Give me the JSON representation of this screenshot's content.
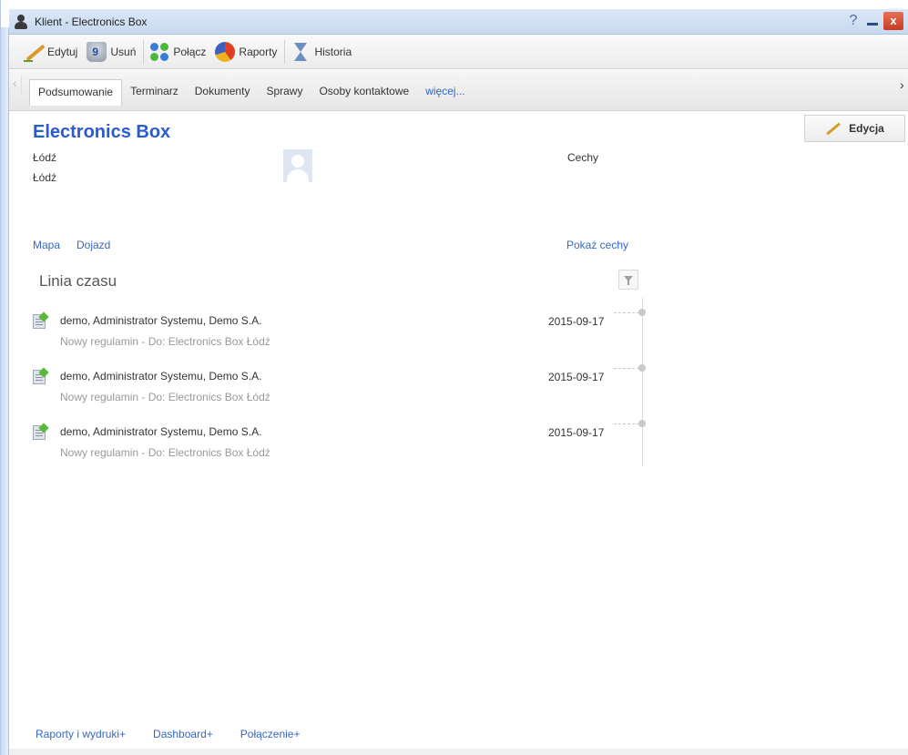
{
  "window": {
    "title": "Klient - Electronics Box",
    "help_symbol": "?",
    "close_symbol": "x"
  },
  "toolbar": {
    "edit_label": "Edytuj",
    "delete_label": "Usuń",
    "merge_label": "Połącz",
    "reports_label": "Raporty",
    "history_label": "Historia"
  },
  "tabs": {
    "items": [
      "Podsumowanie",
      "Terminarz",
      "Dokumenty",
      "Sprawy",
      "Osoby kontaktowe"
    ],
    "more_label": "więcej...",
    "active": "Podsumowanie",
    "scroll_left": "‹",
    "scroll_right": "›"
  },
  "client": {
    "name": "Electronics Box",
    "city_line1": "Łódź",
    "city_line2": "Łódź",
    "features_label": "Cechy",
    "edit_button_label": "Edycja"
  },
  "links": {
    "map": "Mapa",
    "directions": "Dojazd",
    "show_features": "Pokaż cechy"
  },
  "timeline": {
    "title": "Linia czasu",
    "entries": [
      {
        "author": "demo, Administrator Systemu, Demo S.A.",
        "description": "Nowy regulamin - Do: Electronics Box Łódź",
        "date": "2015-09-17"
      },
      {
        "author": "demo, Administrator Systemu, Demo S.A.",
        "description": "Nowy regulamin - Do: Electronics Box Łódź",
        "date": "2015-09-17"
      },
      {
        "author": "demo, Administrator Systemu, Demo S.A.",
        "description": "Nowy regulamin - Do: Electronics Box Łódź",
        "date": "2015-09-17"
      }
    ]
  },
  "footer": {
    "reports_link": "Raporty i wydruki+",
    "dashboard_link": "Dashboard+",
    "connection_link": "Połączenie+"
  },
  "colors": {
    "link": "#3568c4",
    "client_name": "#2a5bd0",
    "close_button": "#c63a22"
  }
}
